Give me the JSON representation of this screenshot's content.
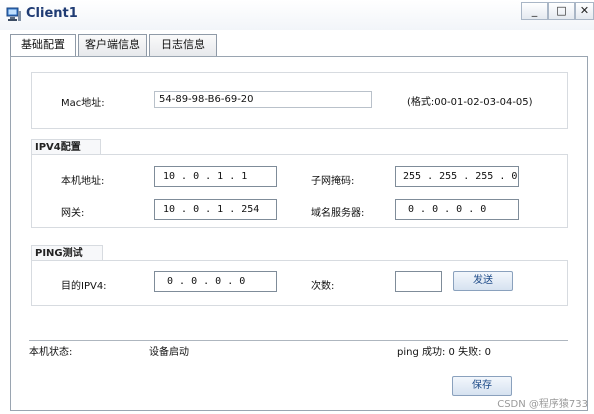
{
  "window": {
    "title": "Client1",
    "minimize_label": "_",
    "maximize_label": "□",
    "close_label": "✕"
  },
  "tabs": [
    {
      "label": "基础配置",
      "active": true
    },
    {
      "label": "客户端信息",
      "active": false
    },
    {
      "label": "日志信息",
      "active": false
    }
  ],
  "mac": {
    "label": "Mac地址:",
    "value": "54-89-98-B6-69-20",
    "hint": "(格式:00-01-02-03-04-05)"
  },
  "ipv4": {
    "title": "IPV4配置",
    "local_ip_label": "本机地址:",
    "local_ip": "10 . 0 . 1 . 1",
    "subnet_label": "子网掩码:",
    "subnet": "255 . 255 . 255 . 0",
    "gateway_label": "网关:",
    "gateway": "10 . 0 . 1 . 254",
    "dns_label": "域名服务器:",
    "dns": "0 . 0 . 0 . 0"
  },
  "ping": {
    "title": "PING测试",
    "dest_label": "目的IPV4:",
    "dest": "0 . 0 . 0 . 0",
    "count_label": "次数:",
    "count": "",
    "send_label": "发送"
  },
  "status": {
    "label": "本机状态:",
    "value": "设备启动",
    "ping_result": "ping 成功: 0 失败: 0"
  },
  "save_label": "保存",
  "watermark": "CSDN @程序猿733"
}
